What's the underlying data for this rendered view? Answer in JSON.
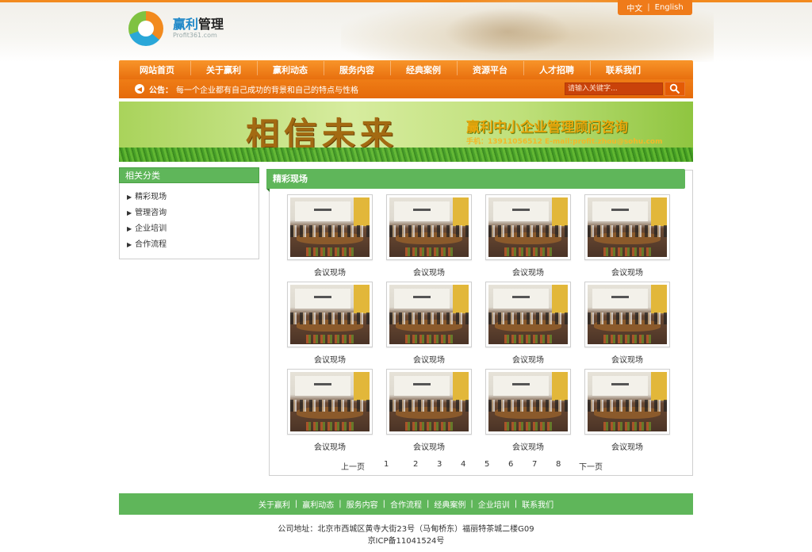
{
  "header": {
    "lang": {
      "zh": "中文",
      "sep": "|",
      "en": "English"
    },
    "logo": {
      "name_blue": "赢利",
      "name": "管理",
      "sub": "Profit361.com"
    }
  },
  "nav": {
    "items": [
      "网站首页",
      "关于赢利",
      "赢利动态",
      "服务内容",
      "经典案例",
      "资源平台",
      "人才招聘",
      "联系我们"
    ]
  },
  "notice": {
    "label": "公告：",
    "text": "每一个企业都有自己成功的背景和自己的特点与性格",
    "search_placeholder": "请输入关键字...",
    "search_icon": "magnifier-icon"
  },
  "banner": {
    "script": "相信未来",
    "title": "赢利中小企业管理顾问咨询",
    "contact": "手机：13911056512  E-mail:profit.zhou@sohu.com"
  },
  "sidebar": {
    "title": "相关分类",
    "items": [
      "精彩现场",
      "管理咨询",
      "企业培训",
      "合作流程"
    ]
  },
  "main": {
    "title": "精彩现场",
    "captions": [
      "会议现场",
      "会议现场",
      "会议现场",
      "会议现场",
      "会议现场",
      "会议现场",
      "会议现场",
      "会议现场",
      "会议现场",
      "会议现场",
      "会议现场",
      "会议现场"
    ],
    "pager": {
      "prev": "上一页",
      "pages": [
        "1",
        "2",
        "3",
        "4",
        "5",
        "6",
        "7",
        "8"
      ],
      "next": "下一页"
    }
  },
  "footer": {
    "links": [
      "关于赢利",
      "赢利动态",
      "服务内容",
      "合作流程",
      "经典案例",
      "企业培训",
      "联系我们"
    ],
    "address": "公司地址：北京市西城区黄寺大街23号（马甸桥东）福丽特茶城二楼G09",
    "icp": "京ICP备11041524号"
  },
  "colors": {
    "orange": "#ef7b1a",
    "green": "#5fb65a"
  }
}
